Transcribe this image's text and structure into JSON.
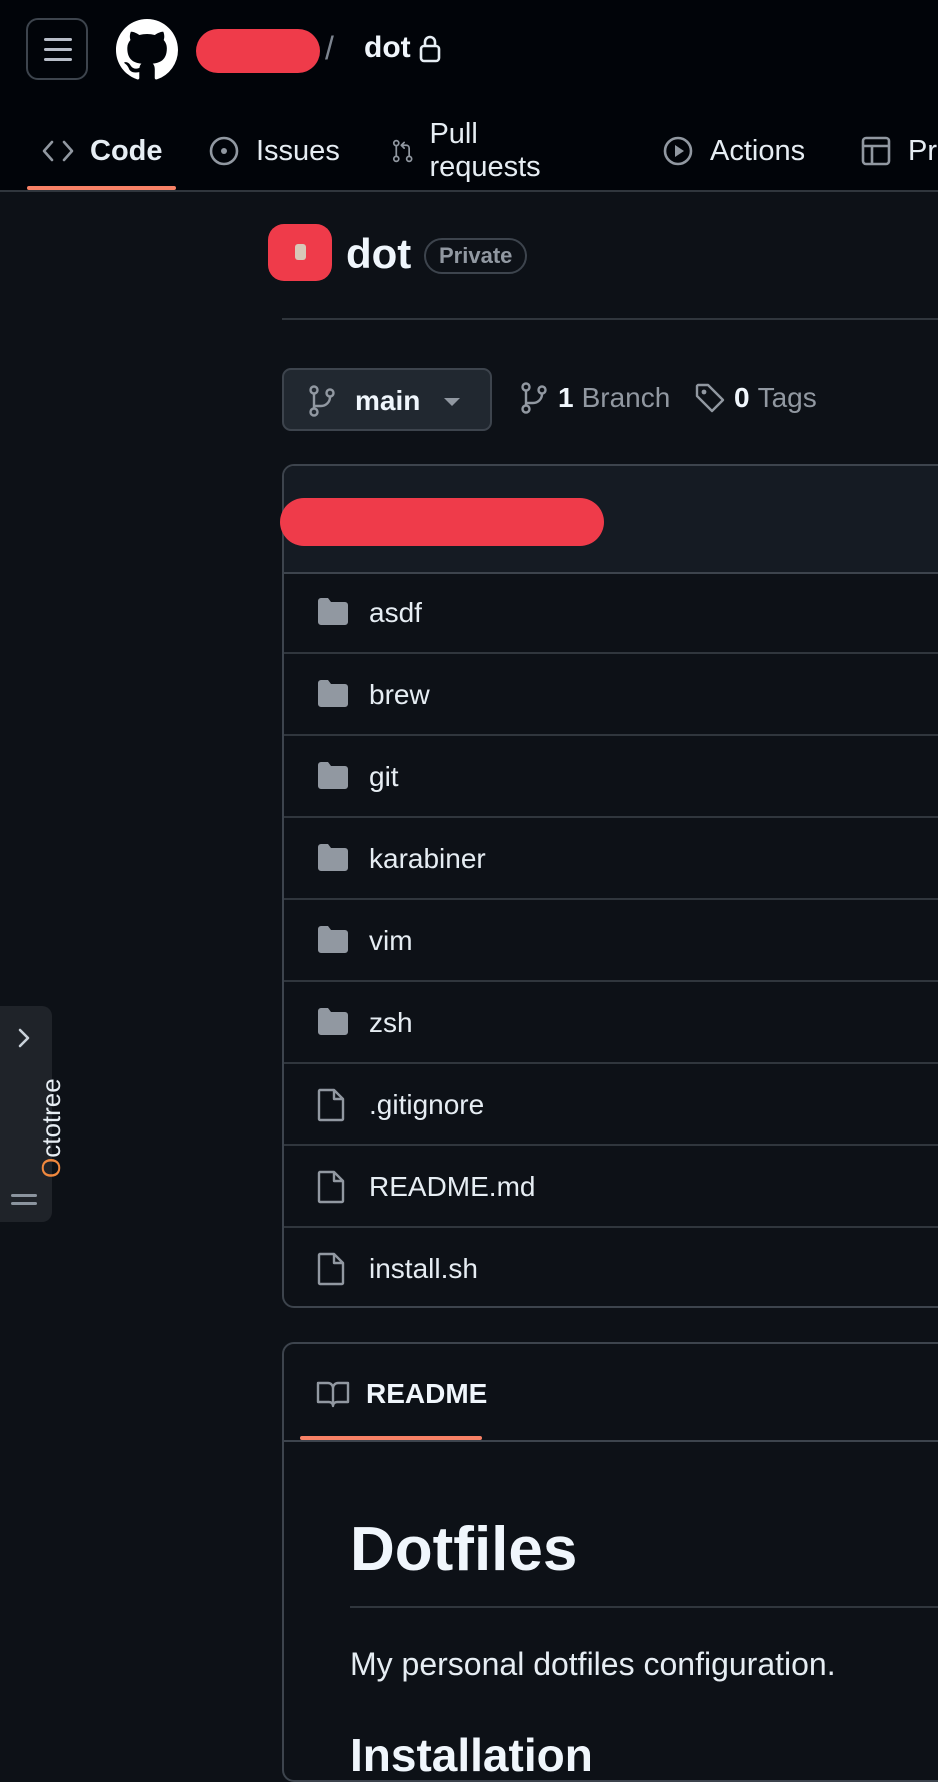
{
  "header": {
    "repo_name": "dot",
    "separator": "/",
    "tabs": [
      {
        "label": "Code",
        "icon": "code-icon",
        "active": true
      },
      {
        "label": "Issues",
        "icon": "issue-opened-icon"
      },
      {
        "label": "Pull requests",
        "icon": "git-pull-request-icon"
      },
      {
        "label": "Actions",
        "icon": "play-icon"
      },
      {
        "label": "Pr",
        "icon": "table-icon"
      }
    ]
  },
  "repo": {
    "title": "dot",
    "visibility": "Private",
    "branch": "main",
    "branch_count": "1",
    "branch_label": "Branch",
    "tag_count": "0",
    "tag_label": "Tags"
  },
  "files": [
    {
      "name": "asdf",
      "type": "folder"
    },
    {
      "name": "brew",
      "type": "folder"
    },
    {
      "name": "git",
      "type": "folder"
    },
    {
      "name": "karabiner",
      "type": "folder"
    },
    {
      "name": "vim",
      "type": "folder"
    },
    {
      "name": "zsh",
      "type": "folder"
    },
    {
      "name": ".gitignore",
      "type": "file"
    },
    {
      "name": "README.md",
      "type": "file"
    },
    {
      "name": "install.sh",
      "type": "file"
    }
  ],
  "readme": {
    "tab_label": "README",
    "heading": "Dotfiles",
    "description": "My personal dotfiles configuration.",
    "subheading": "Installation"
  },
  "octotree": {
    "first_letter": "O",
    "rest": "ctotree"
  },
  "colors": {
    "accent": "#f78166",
    "redaction": "#ef3b4a",
    "background": "#0d1117"
  }
}
